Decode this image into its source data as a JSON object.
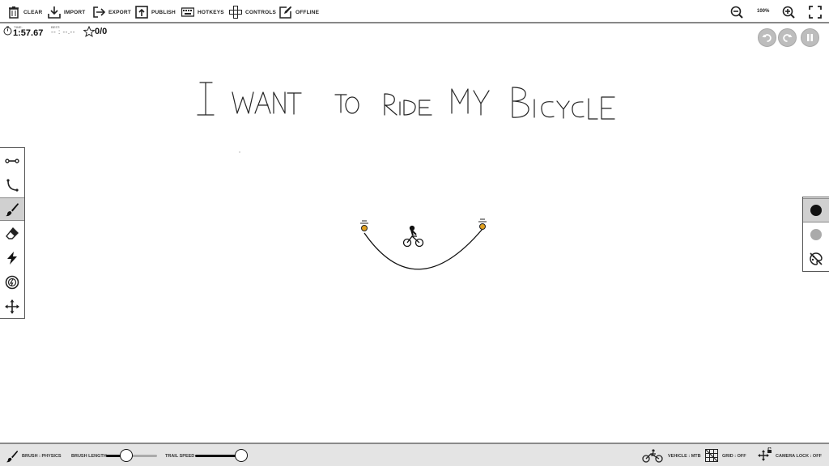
{
  "toolbar": {
    "clear": "CLEAR",
    "import": "IMPORT",
    "export": "EXPORT",
    "publish": "PUBLISH",
    "hotkeys": "HOTKEYS",
    "controls": "CONTROLS",
    "offline": "OFFLINE",
    "zoom": "100%"
  },
  "hud": {
    "time_label": "TIME:",
    "time": "1:57.67",
    "best_label": "BEST:",
    "best": "-- : --.--",
    "stars": "0/0"
  },
  "track": {
    "title_text": "I WANT TO RIDE MY BICYCLE"
  },
  "left_tools": [
    "straight-line",
    "curve",
    "brush",
    "eraser",
    "lightning",
    "boost",
    "move"
  ],
  "active_tool": "brush",
  "right_tools": [
    "physics-line",
    "scenery-line",
    "toggle-color"
  ],
  "bottom": {
    "brush": "BRUSH : PHYSICS",
    "brush_length": "BRUSH LENGTH",
    "brush_length_value": 0.4,
    "trail_speed": "TRAIL SPEED",
    "trail_speed_value": 1.0,
    "vehicle": "VEHICLE : MTB",
    "grid": "GRID : OFF",
    "camera_lock": "CAMERA LOCK : OFF"
  },
  "colors": {
    "accent": "#111111",
    "active_bg": "#d0d0d0",
    "bottom_bg": "#e4e4e4",
    "target": "#e0a020"
  }
}
